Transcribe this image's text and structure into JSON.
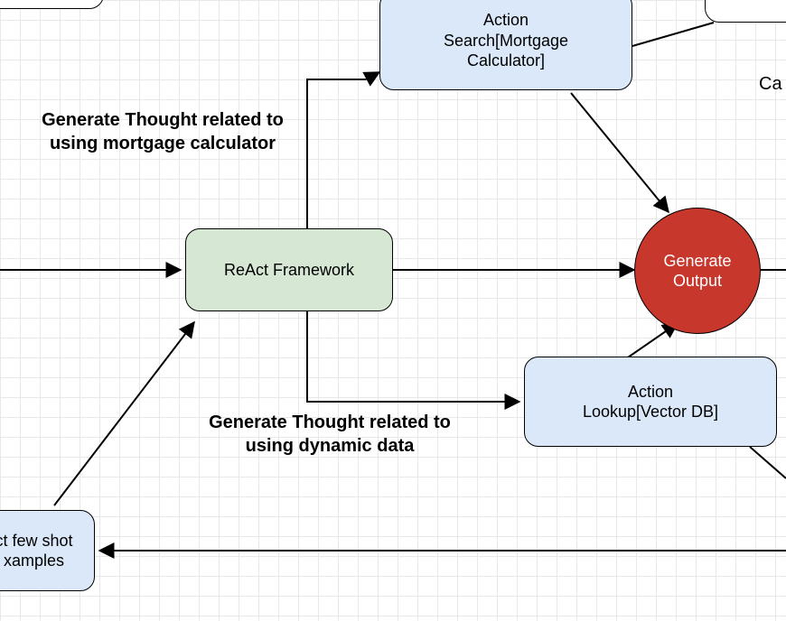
{
  "nodes": {
    "action_search": {
      "line1": "Action",
      "line2": "Search[Mortgage",
      "line3": "Calculator]"
    },
    "react_framework": "ReAct Framework",
    "generate_output": {
      "line1": "Generate",
      "line2": "Output"
    },
    "action_lookup": {
      "line1": "Action",
      "line2": "Lookup[Vector DB]"
    },
    "few_shot": {
      "line1": "ct few shot",
      "line2": "xamples"
    },
    "top_right_partial": "Ca",
    "top_left_partial": ""
  },
  "labels": {
    "thought_mortgage": {
      "line1": "Generate Thought related to",
      "line2": "using mortgage calculator"
    },
    "thought_dynamic": {
      "line1": "Generate Thought related to",
      "line2": "using dynamic data"
    }
  },
  "chart_data": {
    "type": "flowchart",
    "nodes": [
      {
        "id": "action_search",
        "label": "Action Search[Mortgage Calculator]",
        "shape": "rounded-rect",
        "fill": "#dbe8f9"
      },
      {
        "id": "react_framework",
        "label": "ReAct Framework",
        "shape": "rounded-rect",
        "fill": "#d6e8d4"
      },
      {
        "id": "generate_output",
        "label": "Generate Output",
        "shape": "circle",
        "fill": "#c8372c"
      },
      {
        "id": "action_lookup",
        "label": "Action Lookup[Vector DB]",
        "shape": "rounded-rect",
        "fill": "#dbe8f9"
      },
      {
        "id": "few_shot",
        "label": "ct few shot xamples",
        "shape": "rounded-rect",
        "fill": "#dbe8f9",
        "partial": true
      },
      {
        "id": "top_left_partial",
        "label": "",
        "shape": "rounded-rect",
        "partial": true
      },
      {
        "id": "top_right_partial",
        "label": "Ca",
        "shape": "rounded-rect",
        "partial": true
      }
    ],
    "edges": [
      {
        "from": "offscreen-left",
        "to": "react_framework",
        "arrow": true
      },
      {
        "from": "few_shot",
        "to": "react_framework",
        "arrow": true
      },
      {
        "from": "react_framework",
        "to": "action_search",
        "arrow": true,
        "label": "Generate Thought related to using mortgage calculator"
      },
      {
        "from": "react_framework",
        "to": "action_lookup",
        "arrow": true,
        "label": "Generate Thought related to using dynamic data"
      },
      {
        "from": "react_framework",
        "to": "generate_output",
        "arrow": true
      },
      {
        "from": "action_search",
        "to": "generate_output",
        "arrow": true
      },
      {
        "from": "action_lookup",
        "to": "generate_output",
        "arrow": true
      },
      {
        "from": "action_search",
        "to": "top_right_partial",
        "arrow": false
      },
      {
        "from": "action_lookup",
        "to": "offscreen-right",
        "arrow": false
      },
      {
        "from": "generate_output",
        "to": "offscreen-right",
        "arrow": false
      },
      {
        "from": "few_shot",
        "to": "offscreen-right",
        "arrow": true,
        "reversed": true
      }
    ]
  }
}
